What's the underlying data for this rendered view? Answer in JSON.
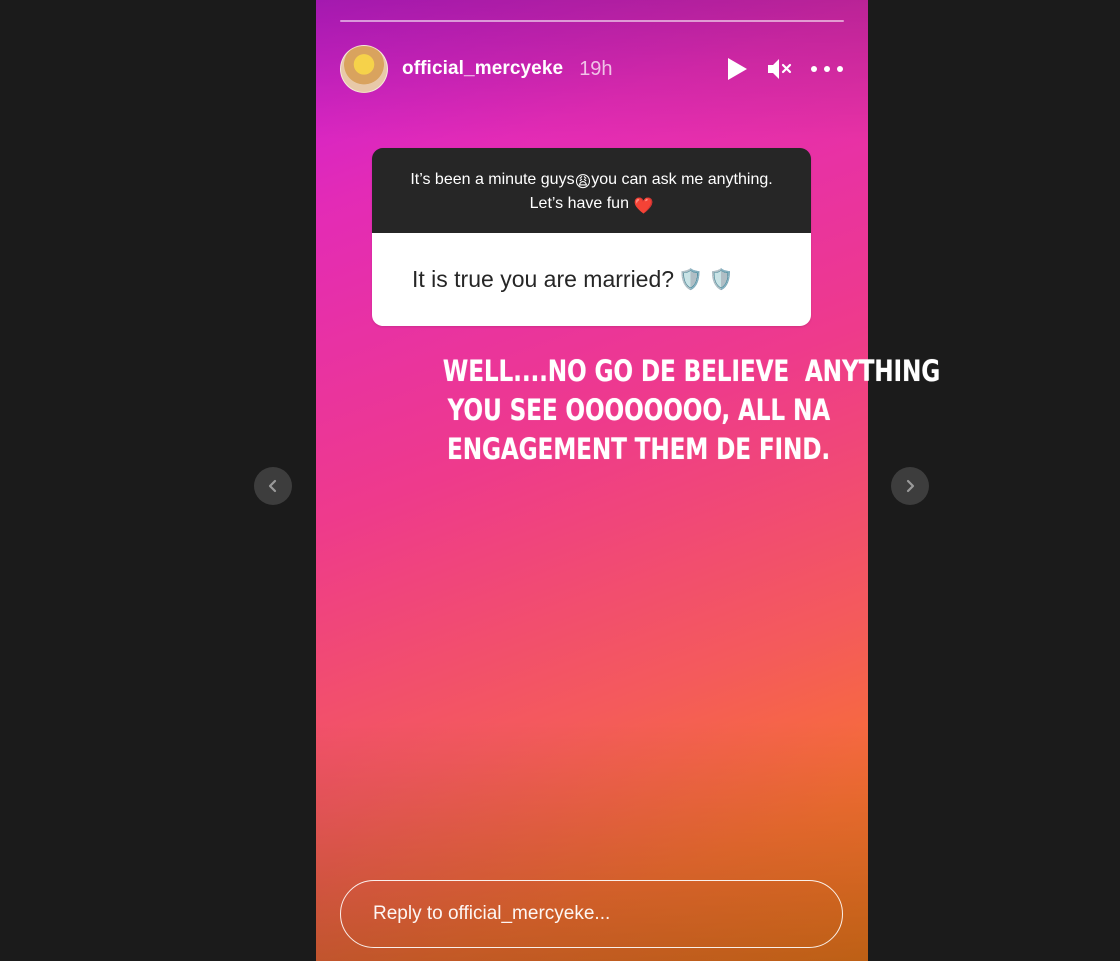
{
  "story": {
    "username": "official_mercyeke",
    "time_ago": "19h",
    "progress_segments": 1,
    "avatar_icon": "avatar-photo"
  },
  "header_controls": {
    "play_icon": "play-icon",
    "mute_icon": "mute-icon",
    "more_icon": "more-icon"
  },
  "question_box": {
    "prompt_part1": "It’s been a minute guys",
    "prompt_emoji1": "😩",
    "prompt_part2": "you can ask me anything. Let’s have fun",
    "prompt_emoji2": "❤️",
    "question_text": "It is true you are married?",
    "question_emojis": "🛡️ 🛡️"
  },
  "caption": {
    "line1": "WELL....NO GO DE BELIEVE  ANYTHING",
    "line2": "YOU SEE OOOOOOOO, ALL NA",
    "line3": "ENGAGEMENT THEM DE FIND."
  },
  "reply": {
    "placeholder": "Reply to official_mercyeke..."
  },
  "nav": {
    "prev_icon": "chevron-left-icon",
    "next_icon": "chevron-right-icon"
  },
  "colors": {
    "background": "#1b1b1b",
    "gradient_top": "#c81ed6",
    "gradient_mid": "#ee3a8c",
    "gradient_bottom": "#f37b1b",
    "question_header": "#262626"
  }
}
